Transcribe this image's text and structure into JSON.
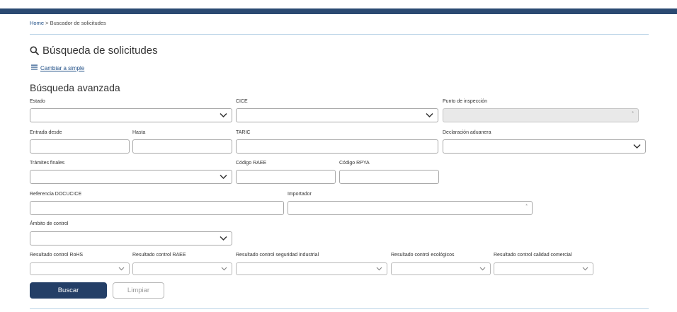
{
  "breadcrumb": {
    "home": "Home",
    "separator": ">",
    "current": "Buscador de solicitudes"
  },
  "page_title": "Búsqueda de solicitudes",
  "mode_toggle": "Cambiar a simple",
  "section_title": "Búsqueda avanzada",
  "fields": {
    "estado": {
      "label": "Estado",
      "value": ""
    },
    "cice": {
      "label": "CICE",
      "value": ""
    },
    "punto_inspeccion": {
      "label": "Punto de inspección",
      "value": "",
      "marker": "*"
    },
    "entrada_desde": {
      "label": "Entrada desde",
      "value": ""
    },
    "hasta": {
      "label": "Hasta",
      "value": ""
    },
    "taric": {
      "label": "TARIC",
      "value": ""
    },
    "declaracion_aduanera": {
      "label": "Declaración aduanera",
      "value": ""
    },
    "tramites_finales": {
      "label": "Trámites finales",
      "value": ""
    },
    "codigo_raee": {
      "label": "Código RAEE",
      "value": ""
    },
    "codigo_rpya": {
      "label": "Código RPYA",
      "value": ""
    },
    "referencia_docucice": {
      "label": "Referencia DOCUCICE",
      "value": ""
    },
    "importador": {
      "label": "Importador",
      "value": "",
      "marker": "*"
    },
    "ambito_control": {
      "label": "Ámbito de control",
      "value": ""
    },
    "res_rohs": {
      "label": "Resultado control RoHS",
      "value": ""
    },
    "res_raee": {
      "label": "Resultado control RAEE",
      "value": ""
    },
    "res_seguridad": {
      "label": "Resultado control seguridad industrial",
      "value": ""
    },
    "res_ecologicos": {
      "label": "Resultado control ecológicos",
      "value": ""
    },
    "res_calidad": {
      "label": "Resultado control calidad comercial",
      "value": ""
    }
  },
  "buttons": {
    "search": "Buscar",
    "clear": "Limpiar"
  },
  "colors": {
    "header_bar": "#2b4a72",
    "link": "#1f4e86",
    "primary_button": "#243f67",
    "divider": "#b9d3e6"
  }
}
